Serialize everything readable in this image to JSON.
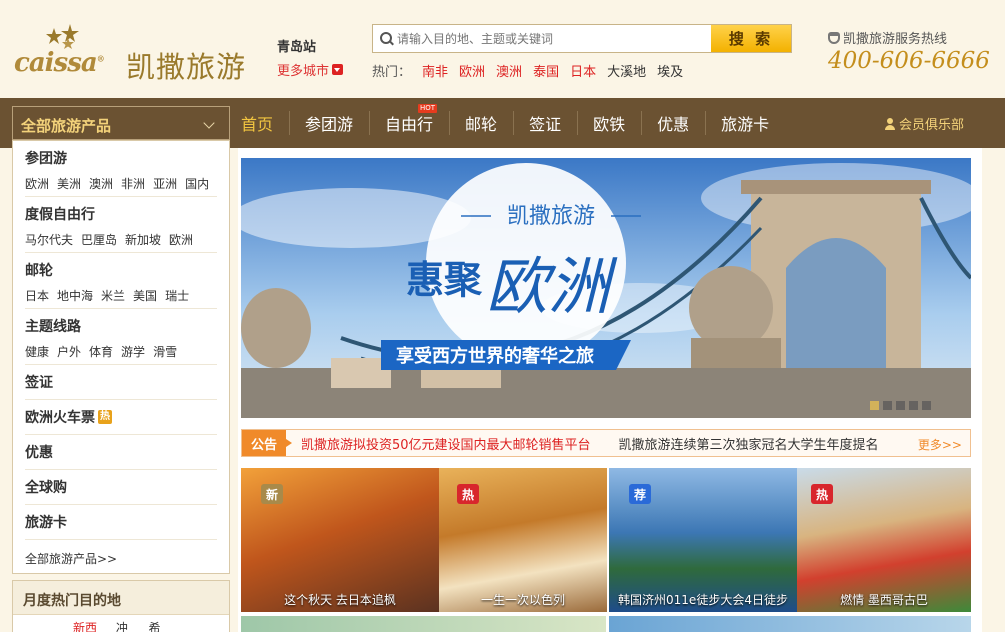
{
  "brand": {
    "name_en": "caissa",
    "name_cn": "凯撒旅游"
  },
  "city": {
    "current": "青岛站",
    "more": "更多城市"
  },
  "search": {
    "placeholder": "请输入目的地、主题或关键词",
    "button": "搜 索"
  },
  "hot_search": {
    "label": "热门：",
    "items": [
      "南非",
      "欧洲",
      "澳洲",
      "泰国",
      "日本",
      "大溪地",
      "埃及"
    ]
  },
  "hotline": {
    "label": "凯撒旅游服务热线",
    "number": "400-606-6666"
  },
  "nav": {
    "all_products": "全部旅游产品",
    "items": [
      "首页",
      "参团游",
      "自由行",
      "邮轮",
      "签证",
      "欧铁",
      "优惠",
      "旅游卡"
    ],
    "hot_badge": "HOT",
    "club": "会员俱乐部"
  },
  "sidebar": {
    "categories": [
      {
        "title": "参团游",
        "links": [
          "欧洲",
          "美洲",
          "澳洲",
          "非洲",
          "亚洲",
          "国内"
        ]
      },
      {
        "title": "度假自由行",
        "links": [
          "马尔代夫",
          "巴厘岛",
          "新加坡",
          "欧洲"
        ]
      },
      {
        "title": "邮轮",
        "links": [
          "日本",
          "地中海",
          "米兰",
          "美国",
          "瑞士"
        ]
      },
      {
        "title": "主题线路",
        "links": [
          "健康",
          "户外",
          "体育",
          "游学",
          "滑雪"
        ]
      },
      {
        "title": "签证"
      },
      {
        "title": "欧洲火车票",
        "tag": "热"
      },
      {
        "title": "优惠"
      },
      {
        "title": "全球购"
      },
      {
        "title": "旅游卡"
      }
    ],
    "all_link": "全部旅游产品>>"
  },
  "hot_destinations": {
    "title": "月度热门目的地",
    "items": [
      "新西兰",
      "冲绳",
      "希腊"
    ]
  },
  "banner": {
    "brand": "凯撒旅游",
    "headline_a": "惠聚",
    "headline_b": "欧洲",
    "subline": "享受西方世界的奢华之旅",
    "slide_count": 5,
    "active_slide": 1
  },
  "notice": {
    "label": "公告",
    "items": [
      "凯撒旅游拟投资50亿元建设国内最大邮轮销售平台",
      "凯撒旅游连续第三次独家冠名大学生年度提名"
    ],
    "more": "更多>>"
  },
  "tiles": [
    {
      "tag": "新",
      "caption": "这个秋天 去日本追枫",
      "tag_color": "#a88a4a"
    },
    {
      "tag": "热",
      "caption": "一生一次以色列",
      "tag_color": "#d8262c"
    },
    {
      "tag": "荐",
      "caption": "韩国济州011e徒步大会4日徒步",
      "tag_color": "#2a6ad8"
    },
    {
      "tag": "热",
      "caption": "燃情 墨西哥古巴",
      "tag_color": "#d8262c"
    }
  ],
  "colors": {
    "nav_bg": "#6b5232",
    "gold": "#c48e1c",
    "accent_red": "#d22",
    "search_btn": "#f3b100"
  }
}
